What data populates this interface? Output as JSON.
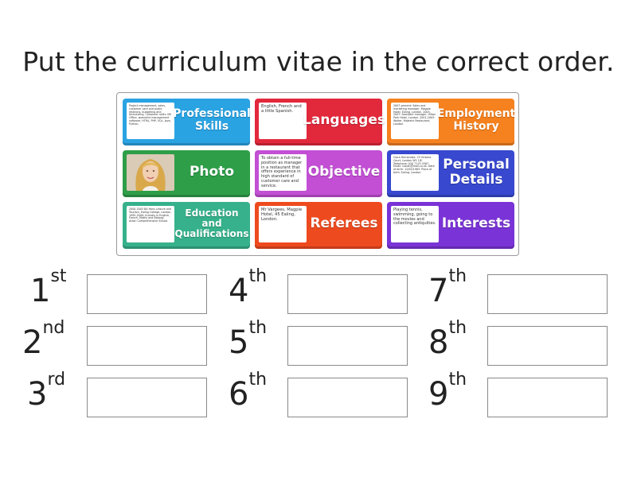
{
  "title": "Put the curriculum vitae in the correct order.",
  "colors": {
    "blue": "#2aa3e3",
    "red": "#e2283b",
    "orange": "#f5811f",
    "green": "#2e9e48",
    "purple": "#c24fd4",
    "indigo": "#3848cf",
    "teal": "#36b18b",
    "red_orange": "#ee4a1f",
    "violet": "#7a33d6"
  },
  "tiles": [
    {
      "label": "Professional Skills",
      "thumb_text": "Project management, sales, customer care and public relations, budgeting and forecasting. Computer skills: MS Office, specialist management software, HTML, PHP, SQL, Java, Python.",
      "icon": "document-thumbnail"
    },
    {
      "label": "Languages",
      "thumb_text": "English, French and a little Spanish.",
      "icon": "document-thumbnail"
    },
    {
      "label": "Employment History",
      "thumb_text": "2007-present: Sales and marketing manager, Magpie Hotel, Ealing, London. 2003-2007: Assistant manager, Hilton Park Hotel, London. 2001-2003: Waiter, Majestic Restaurant, London.",
      "icon": "document-thumbnail"
    },
    {
      "label": "Photo",
      "thumb_text": "",
      "icon": "portrait-photo"
    },
    {
      "label": "Objective",
      "thumb_text": "To obtain a full-time position as manager in a restaurant that offers experience in high standard of customer care and service.",
      "icon": "document-thumbnail"
    },
    {
      "label": "Personal Details",
      "thumb_text": "Clara Hernandez. 23 Victoria Court, London W5 1JE. Telephone: 020 7123 4567. Email: clarah@mail.co.uk. Date of birth: 12/05/1983. Place of birth: Ealing, London.",
      "icon": "document-thumbnail"
    },
    {
      "label": "Education and Qualifications",
      "thumb_text": "2000-2003 BA Hons Leisure and Tourism, Ealing College, London. 1995-2000: A-levels in English, French, Maths and Biology, Acton Comprehensive School.",
      "icon": "document-thumbnail"
    },
    {
      "label": "Referees",
      "thumb_text": "Mr Vargees, Magpie Hotel, 45 Ealing, London.",
      "icon": "document-thumbnail"
    },
    {
      "label": "Interests",
      "thumb_text": "Playing tennis, swimming, going to the movies and collecting antiquities.",
      "icon": "document-thumbnail"
    }
  ],
  "slots": [
    {
      "num": "1",
      "suffix": "st"
    },
    {
      "num": "2",
      "suffix": "nd"
    },
    {
      "num": "3",
      "suffix": "rd"
    },
    {
      "num": "4",
      "suffix": "th"
    },
    {
      "num": "5",
      "suffix": "th"
    },
    {
      "num": "6",
      "suffix": "th"
    },
    {
      "num": "7",
      "suffix": "th"
    },
    {
      "num": "8",
      "suffix": "th"
    },
    {
      "num": "9",
      "suffix": "th"
    }
  ]
}
